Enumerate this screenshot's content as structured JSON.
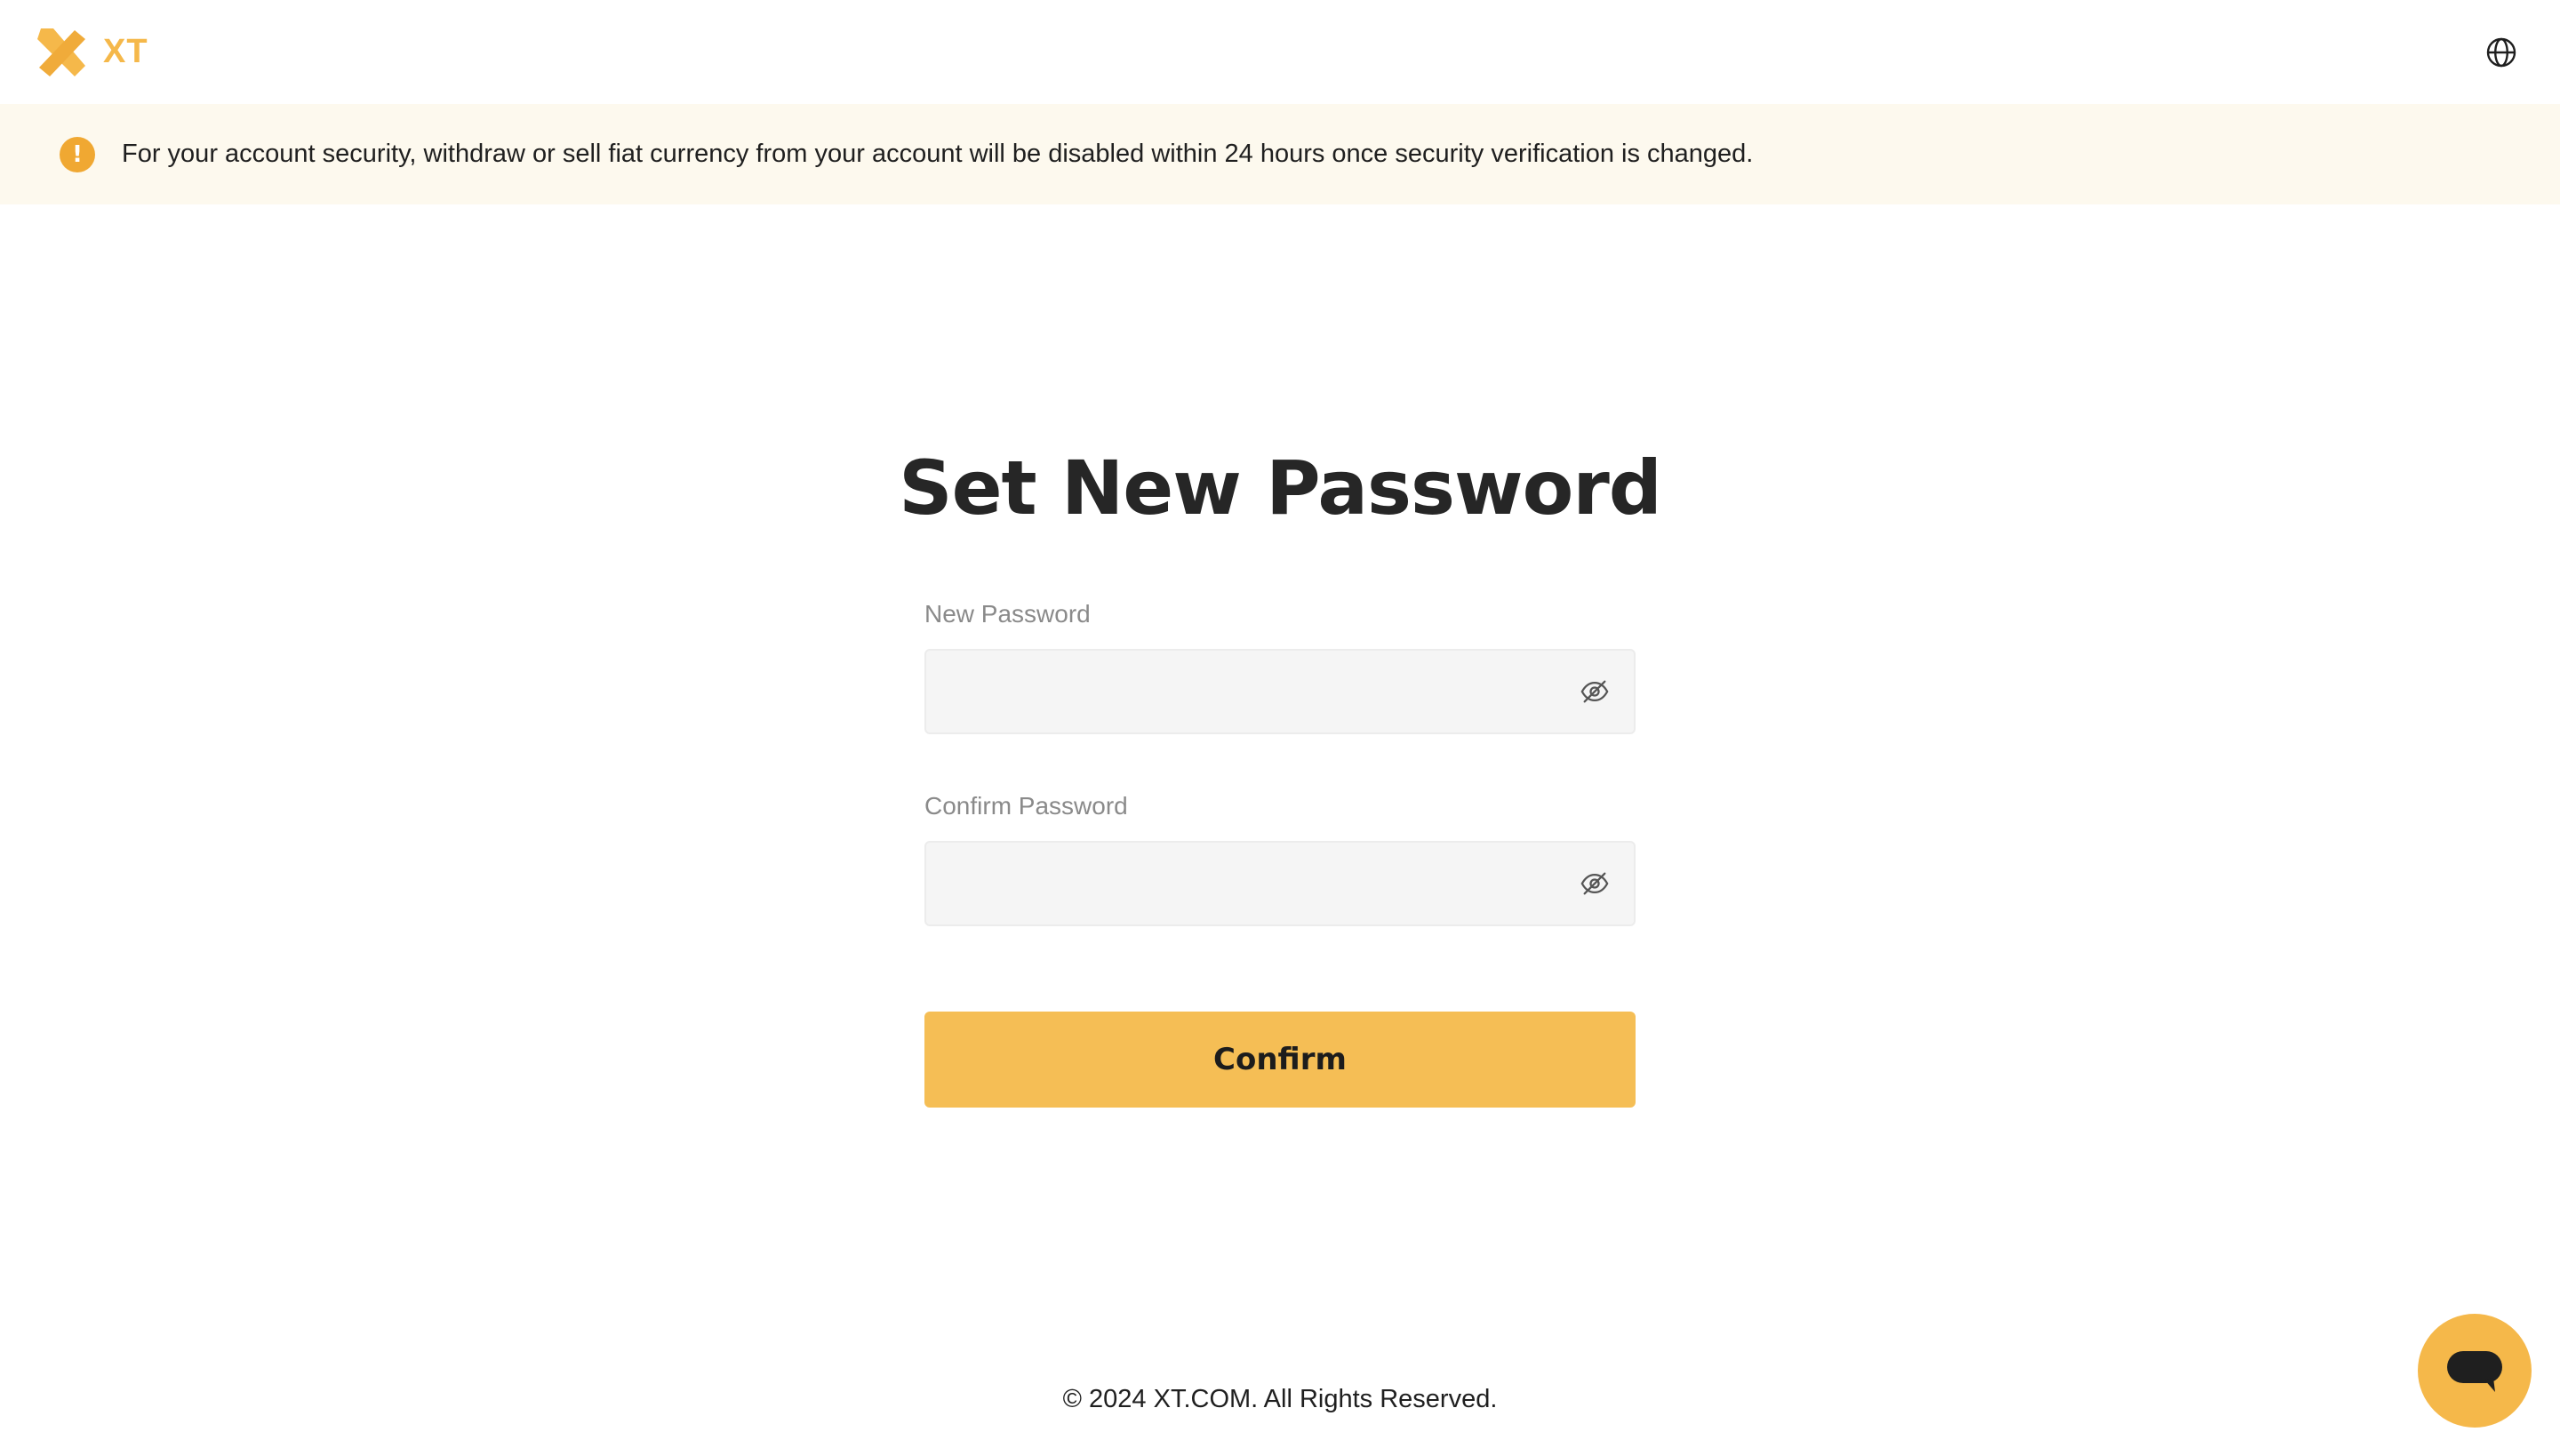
{
  "brand": {
    "name": "XT",
    "accent_color": "#f5b84a"
  },
  "header": {
    "language_icon": "globe-icon"
  },
  "notice": {
    "icon": "exclamation-icon",
    "icon_glyph": "!",
    "text": "For your account security, withdraw or sell fiat currency from your account will be disabled within 24 hours once security verification is changed."
  },
  "form": {
    "title": "Set New Password",
    "new_password": {
      "label": "New Password",
      "value": "",
      "visibility_icon": "eye-off-icon"
    },
    "confirm_password": {
      "label": "Confirm Password",
      "value": "",
      "visibility_icon": "eye-off-icon"
    },
    "submit_label": "Confirm"
  },
  "footer": {
    "copyright": "© 2024 XT.COM. All Rights Reserved."
  },
  "chat": {
    "icon": "chat-bubble-icon"
  }
}
